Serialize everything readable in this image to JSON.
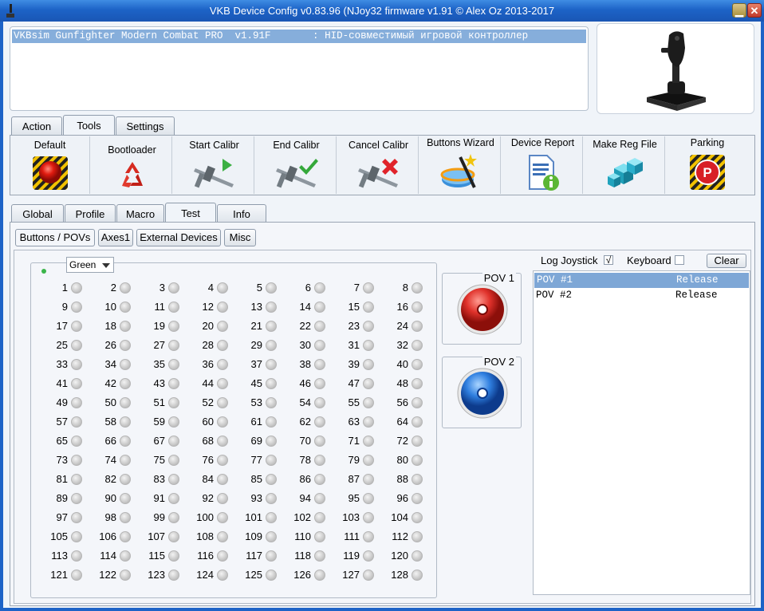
{
  "window": {
    "title": "VKB Device Config v0.83.96 (NJoy32 firmware v1.91 © Alex Oz 2013-2017"
  },
  "device_list": {
    "selected": "VKBsim Gunfighter Modern Combat PRO  v1.91F       : HID-совместимый игровой контроллер"
  },
  "main_tabs": [
    {
      "label": "Action"
    },
    {
      "label": "Tools"
    },
    {
      "label": "Settings"
    }
  ],
  "tools": [
    {
      "label": "Default",
      "icon": "red-button-icon"
    },
    {
      "label": "Bootloader",
      "icon": "recycle-icon"
    },
    {
      "label": "Start Calibr",
      "icon": "caliper-play-icon"
    },
    {
      "label": "End Calibr",
      "icon": "caliper-check-icon"
    },
    {
      "label": "Cancel Calibr",
      "icon": "caliper-cross-icon"
    },
    {
      "label": "Buttons Wizard",
      "icon": "wizard-wand-icon"
    },
    {
      "label": "Device Report",
      "icon": "report-info-icon"
    },
    {
      "label": "Make Reg File",
      "icon": "registry-cubes-icon"
    },
    {
      "label": "Parking",
      "icon": "parking-icon"
    }
  ],
  "config_tabs": [
    {
      "label": "Global"
    },
    {
      "label": "Profile"
    },
    {
      "label": "Macro"
    },
    {
      "label": "Test"
    },
    {
      "label": "Info"
    }
  ],
  "test_subtabs": [
    {
      "label": "Buttons / POVs"
    },
    {
      "label": "Axes1"
    },
    {
      "label": "External Devices"
    },
    {
      "label": "Misc"
    }
  ],
  "color_select": {
    "value": "Green"
  },
  "buttons": {
    "count": 128,
    "columns": 8
  },
  "povs": [
    {
      "label": "POV 1",
      "color": "#e0322b"
    },
    {
      "label": "POV 2",
      "color": "#2f7fe0"
    }
  ],
  "log": {
    "log_joystick_label": "Log Joystick",
    "log_joystick_checked": true,
    "keyboard_label": "Keyboard",
    "keyboard_checked": false,
    "clear_label": "Clear",
    "rows": [
      {
        "event": "POV #1",
        "state": "Release"
      },
      {
        "event": "POV #2",
        "state": "Release"
      }
    ]
  }
}
